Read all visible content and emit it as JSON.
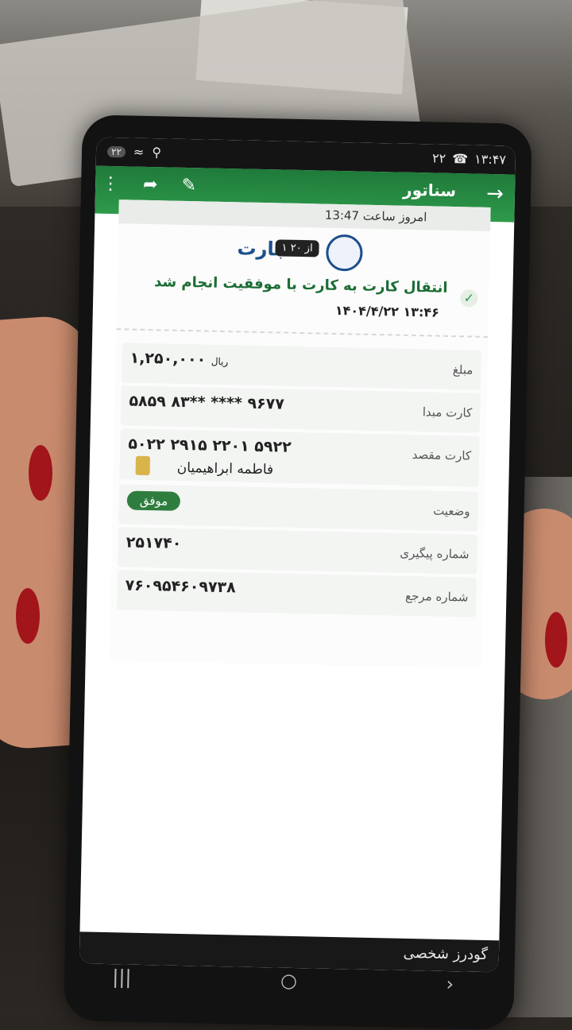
{
  "status_bar": {
    "time": "۱۳:۴۷",
    "notif": "۲۲",
    "left_badge": "۲۲"
  },
  "app_bar": {
    "title": "سناتور",
    "back_icon": "arrow-right-icon",
    "icons": [
      "more-vert-icon",
      "share-icon",
      "brush-icon"
    ]
  },
  "receipt": {
    "header_label": "امروز ساعت 13:47",
    "bank_name": "تجارت",
    "bank_badge": "۱ از ۲۰",
    "success_msg": "انتقال کارت به کارت با موفقیت انجام شد",
    "datetime": "۱۴۰۴/۴/۲۲ ۱۳:۴۶",
    "rows": [
      {
        "label": "مبلغ",
        "value": "۱,۲۵۰,۰۰۰",
        "unit": "ریال"
      },
      {
        "label": "کارت مبدا",
        "value": "۵۸۵۹ ۸۳** **** ۹۶۷۷"
      },
      {
        "label": "کارت مقصد",
        "value": "۵۰۲۲ ۲۹۱۵ ۲۲۰۱ ۵۹۲۲",
        "sub": "فاطمه ابراهیمیان"
      },
      {
        "label": "وضعیت",
        "value": "موفق"
      },
      {
        "label": "شماره پیگیری",
        "value": "۲۵۱۷۴۰"
      },
      {
        "label": "شماره مرجع",
        "value": "۷۶۰۹۵۴۶۰۹۷۳۸"
      }
    ]
  },
  "footer": {
    "name": "گودرز شخصی"
  },
  "colors": {
    "accent": "#2e9a4b",
    "status_ok": "#2f7d3e"
  }
}
